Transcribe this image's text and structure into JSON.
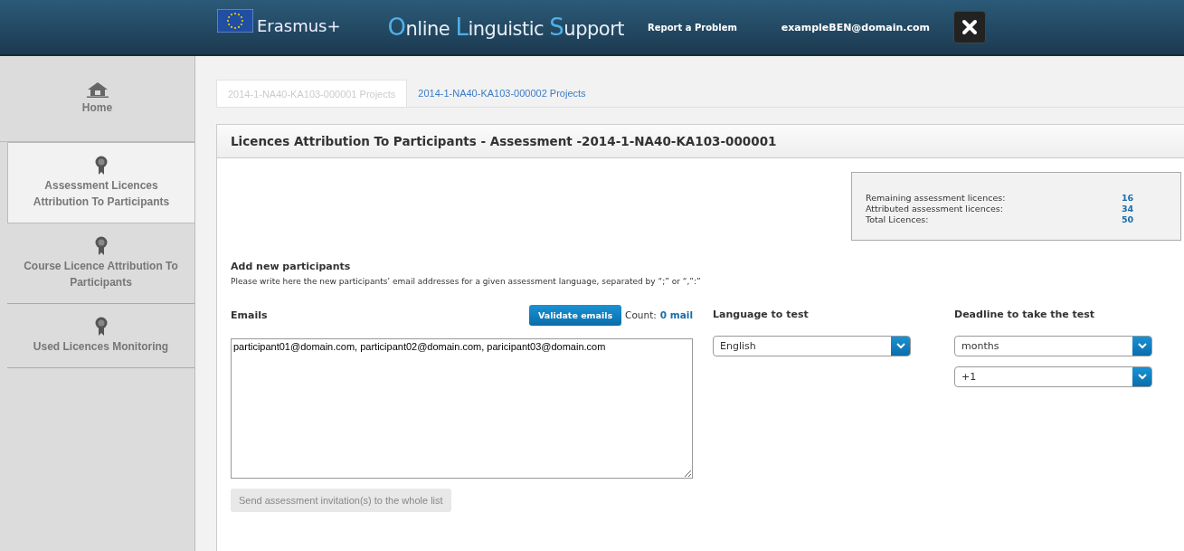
{
  "header": {
    "brand": "Erasmus+",
    "title_parts": [
      {
        "initial": "O",
        "rest": "nline "
      },
      {
        "initial": "L",
        "rest": "inguistic "
      },
      {
        "initial": "S",
        "rest": "upport"
      }
    ],
    "report_link": "Report a Problem",
    "user": "exampleBEN@domain.com"
  },
  "sidebar": {
    "items": [
      {
        "label": "Home",
        "kind": "home",
        "selected": false
      },
      {
        "label": "Assessment Licences Attribution To Participants",
        "kind": "ribbon",
        "selected": true
      },
      {
        "label": "Course Licence Attribution To Participants",
        "kind": "ribbon",
        "selected": false
      },
      {
        "label": "Used Licences Monitoring",
        "kind": "ribbon",
        "selected": false
      }
    ]
  },
  "tabs": [
    {
      "label": "2014-1-NA40-KA103-000001 Projects",
      "selected": true
    },
    {
      "label": "2014-1-NA40-KA103-000002 Projects",
      "selected": false
    }
  ],
  "panel": {
    "title": "Licences Attribution To Participants - Assessment -2014-1-NA40-KA103-000001",
    "summary": [
      {
        "label": "Remaining assessment licences:",
        "value": "16"
      },
      {
        "label": "Attributed assessment licences:",
        "value": "34"
      },
      {
        "label": "Total Licences:",
        "value": "50"
      }
    ],
    "section_title": "Add new participants",
    "instructions": "Please write here the new participants’ email addresses for a given assessment language, separated by “;” or “,”:”",
    "emails_label": "Emails",
    "validate_button": "Validate emails",
    "count_label": "Count:",
    "count_value": "0 mail",
    "emails_value": "participant01@domain.com, participant02@domain.com, paricipant03@domain.com",
    "language_label": "Language to test",
    "language_value": "English",
    "deadline_label": "Deadline to take the test",
    "deadline_unit": "months",
    "deadline_amount": "+1",
    "send_button": {
      "label": "Send assessment invitation(s) to the whole list",
      "disabled": true
    }
  }
}
